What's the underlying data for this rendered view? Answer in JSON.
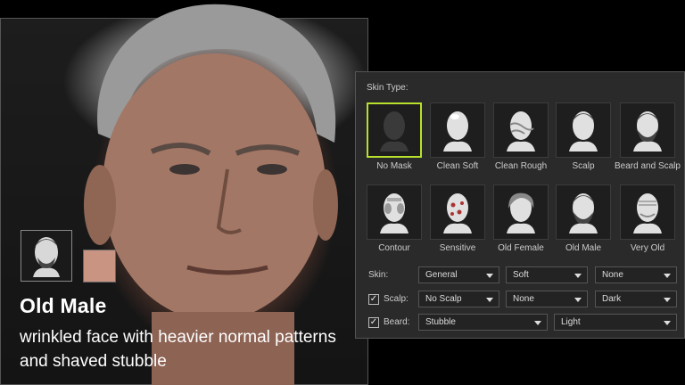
{
  "overlay": {
    "title": "Old Male",
    "description": "wrinkled face with heavier normal patterns and shaved stubble",
    "swatch_color": "#c99482"
  },
  "panel": {
    "skin_type_label": "Skin Type:",
    "tiles": [
      {
        "label": "No Mask",
        "icon": "no-mask-icon",
        "selected": true
      },
      {
        "label": "Clean Soft",
        "icon": "clean-soft-icon",
        "selected": false
      },
      {
        "label": "Clean Rough",
        "icon": "clean-rough-icon",
        "selected": false
      },
      {
        "label": "Scalp",
        "icon": "scalp-icon",
        "selected": false
      },
      {
        "label": "Beard and Scalp",
        "icon": "beard-and-scalp-icon",
        "selected": false
      },
      {
        "label": "Contour",
        "icon": "contour-icon",
        "selected": false
      },
      {
        "label": "Sensitive",
        "icon": "sensitive-icon",
        "selected": false
      },
      {
        "label": "Old Female",
        "icon": "old-female-icon",
        "selected": false
      },
      {
        "label": "Old Male",
        "icon": "old-male-icon",
        "selected": false
      },
      {
        "label": "Very Old",
        "icon": "very-old-icon",
        "selected": false
      }
    ],
    "skin": {
      "label": "Skin:",
      "values": [
        "General",
        "Soft",
        "None"
      ]
    },
    "scalp": {
      "label": "Scalp:",
      "checked": true,
      "values": [
        "No Scalp",
        "None",
        "Dark"
      ]
    },
    "beard": {
      "label": "Beard:",
      "checked": true,
      "values": [
        "Stubble",
        "Light"
      ]
    },
    "accent_color": "#b6e12c"
  }
}
